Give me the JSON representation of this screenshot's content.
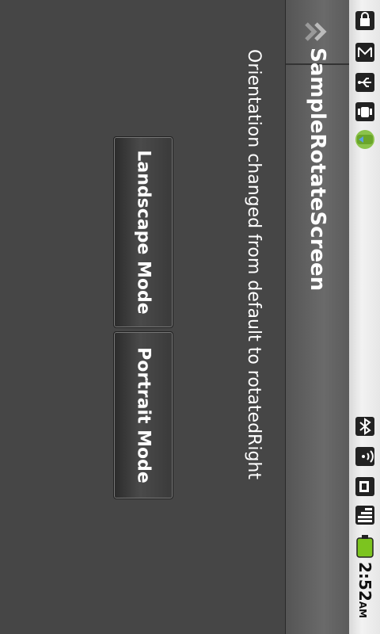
{
  "status_bar": {
    "time": "2:52",
    "ampm": "AM",
    "icons": [
      "lock-icon",
      "gmail-icon",
      "usb-icon",
      "android-debug-icon",
      "android-market-icon",
      "bluetooth-icon",
      "wifi-icon",
      "sim-icon",
      "signal-icon",
      "battery-icon"
    ]
  },
  "title_bar": {
    "title": "SampleRotateScreen",
    "home_icon": "chevron-right-icon"
  },
  "content": {
    "orientation_message": "Orientation changed from default to rotatedRight",
    "landscape_button": "Landscape Mode",
    "portrait_button": "Portrait Mode"
  },
  "colors": {
    "background": "#464646",
    "title_bar": "#5b5b5b",
    "status_bar": "#e6e6e6",
    "battery": "#7cc41f"
  }
}
